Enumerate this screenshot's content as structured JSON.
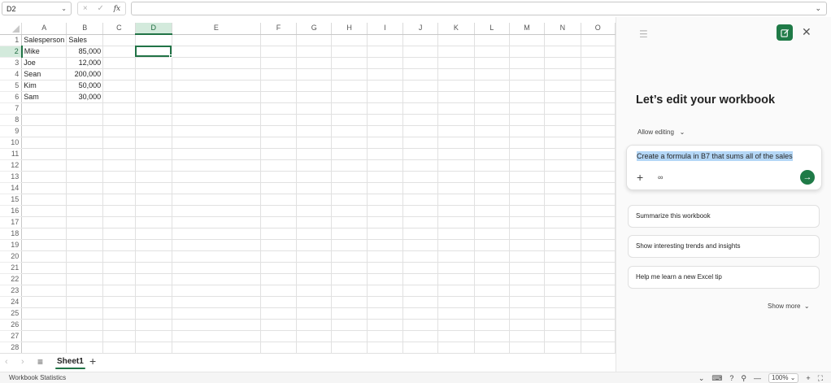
{
  "formula_bar": {
    "name_box": "D2",
    "cancel_icon": "×",
    "enter_icon": "✓",
    "fx_label": "fx",
    "formula_value": ""
  },
  "columns": [
    "A",
    "B",
    "C",
    "D",
    "E",
    "F",
    "G",
    "H",
    "I",
    "J",
    "K",
    "L",
    "M",
    "N",
    "O"
  ],
  "rows": [
    "1",
    "2",
    "3",
    "4",
    "5",
    "6",
    "7",
    "8",
    "9",
    "10",
    "11",
    "12",
    "13",
    "14",
    "15",
    "16",
    "17",
    "18",
    "19",
    "20",
    "21",
    "22",
    "23",
    "24",
    "25",
    "26",
    "27",
    "28"
  ],
  "cells": {
    "A1": "Salesperson",
    "B1": "Sales",
    "A2": "Mike",
    "B2": "85,000",
    "A3": "Joe",
    "B3": "12,000",
    "A4": "Sean",
    "B4": "200,000",
    "A5": "Kim",
    "B5": "50,000",
    "A6": "Sam",
    "B6": "30,000"
  },
  "active_cell": "D2",
  "sheet_tabs": {
    "prev_icon": "‹",
    "next_icon": "›",
    "menu_icon": "≡",
    "active_sheet": "Sheet1",
    "add_icon": "+"
  },
  "status_bar": {
    "left_text": "Workbook Statistics",
    "zoom_value": "100%",
    "zoom_minus": "—",
    "zoom_plus": "+"
  },
  "copilot": {
    "heading": "Let’s edit your workbook",
    "mode_label": "Allow editing",
    "prompt_text": "Create a formula in B7 that sums all of the sales",
    "suggestions": [
      "Summarize this workbook",
      "Show interesting trends and insights",
      "Help me learn a new Excel tip"
    ],
    "show_more": "Show more"
  },
  "colors": {
    "accent": "#1f7a47",
    "selection_highlight": "#b4d7f7",
    "header_selected": "#d3eadc"
  }
}
